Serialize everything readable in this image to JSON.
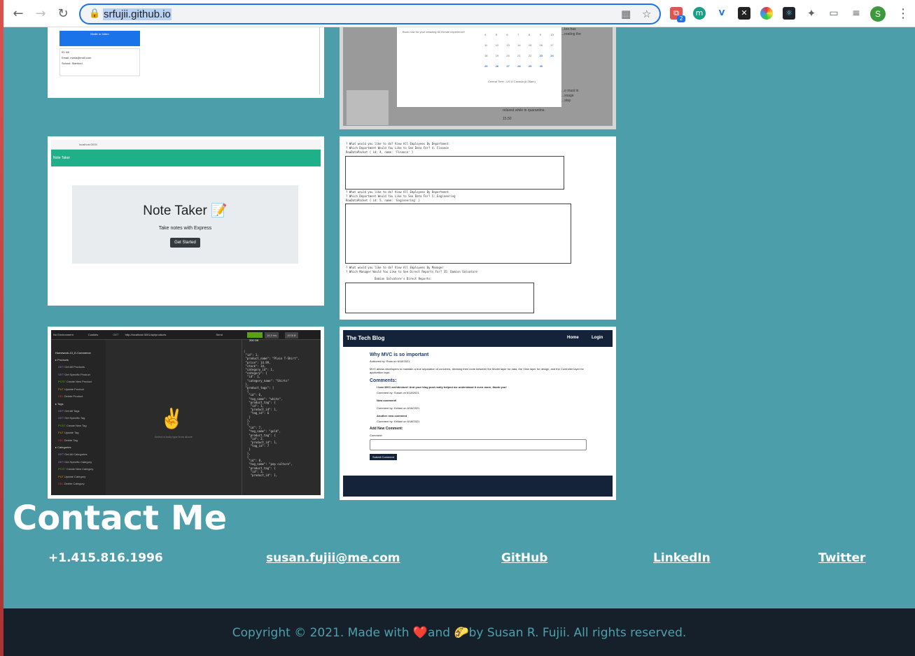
{
  "browser": {
    "url": "srfujii.github.io",
    "profile_initial": "S",
    "ext_badge": "2"
  },
  "thumbs": {
    "t1": {
      "header": "Mollie\nor\nIntern",
      "id": "ID: 68",
      "email": "Email: maria@mail.com",
      "school": "School: Stanford"
    },
    "t2": {
      "booking": "Book now for your amazing 60 minute experience!",
      "timezone": "Central Time - US & Canada (6:28am)",
      "side_text_1": "...too has",
      "side_text_2": "...reating the",
      "side_text_3": "...o must in",
      "side_text_4": "...ssage",
      "side_text_5": "...stay",
      "relaxed": "relaxed while in quarantine.",
      "price": "15.50",
      "days": [
        "4",
        "5",
        "6",
        "7",
        "8",
        "9",
        "10",
        "11",
        "12",
        "13",
        "14",
        "15",
        "16",
        "17",
        "18",
        "19",
        "20",
        "21",
        "22",
        "23",
        "24",
        "25",
        "26",
        "27",
        "28",
        "29",
        "30",
        ""
      ]
    },
    "t3": {
      "address": "localhost:3000",
      "brand": "Note Taker",
      "title": "Note Taker 📝",
      "subtitle": "Take notes with Express",
      "button": "Get Started"
    },
    "t4": {
      "q1": "? What would you like to do? View All Employees By Department",
      "q2": "? Which Department Would You Like to See Data For? 4: Finance",
      "q3": "RowDataPacket { id: 4, name: 'Finance' }",
      "q4": "? What would you like to do? View All Employees By Department",
      "q5": "? Which Department Would You Like to See Data For? 5: Engineering",
      "q6": "RowDataPacket { id: 5, name: 'Engineering' }",
      "q7": "? What would you like to do? View All Employees By Manager",
      "q8": "? Which Manager Would You Like to See Direct Reports For? 35: Damion Salvatore",
      "q9": "Damion Salvatore's Direct Reports:"
    },
    "t5": {
      "env": "No Environment",
      "cookies": "Cookies",
      "method": "GET",
      "url": "http://localhost:3001/api/products",
      "send": "Send",
      "status": "200 OK",
      "time": "16.3 ms",
      "size": "1978 B",
      "workspace": "Homework-13_E-Commerce",
      "hint": "Select a body type from above",
      "folders": [
        "Products",
        "Tags",
        "Categories"
      ],
      "items": [
        "Get All Products",
        "Get Specific Product",
        "Create New Product",
        "Update Product",
        "Delete Product",
        "Get All Tags",
        "Get Specific Tag",
        "Create New Tag",
        "Update Tag",
        "Delete Tag",
        "Get All Categories",
        "Get Specific Category",
        "Create New Category",
        "Update Category",
        "Delete Category"
      ]
    },
    "t6": {
      "brand": "The Tech Blog",
      "nav_home": "Home",
      "nav_login": "Login",
      "post_title": "Why MVC is so important",
      "author": "Authored by: Ross on 6/18/2021",
      "body": "MVC allows developers to maintain a true separation of concerns, devising their code between the Model layer for data, the View layer for design, and the Controller layer for application logic.",
      "comments_title": "Comments:",
      "c1": "I love MVC architecture! And your blog post really helped me understand it even more, thank you!",
      "c1_by": "Comment by: Susan on 6/18/2021",
      "c2": "New comment!",
      "c2_by": "Comment by: Keilani on 6/18/2021",
      "c3": "Another new comment",
      "c3_by": "Comment by: Keilani on 6/18/2021",
      "add_title": "Add New Comment:",
      "label": "Comment:",
      "submit": "Submit Comment"
    }
  },
  "contact": {
    "title": "Contact Me",
    "phone": "+1.415.816.1996",
    "email": "susan.fujii@me.com",
    "github": "GitHub",
    "linkedin": "LinkedIn",
    "twitter": "Twitter"
  },
  "footer": {
    "prefix": "Copyright © 2021. Made with ",
    "heart": "❤️",
    "and": "and ",
    "taco": "🌮",
    "suffix": "by Susan R. Fujii. All rights reserved."
  }
}
